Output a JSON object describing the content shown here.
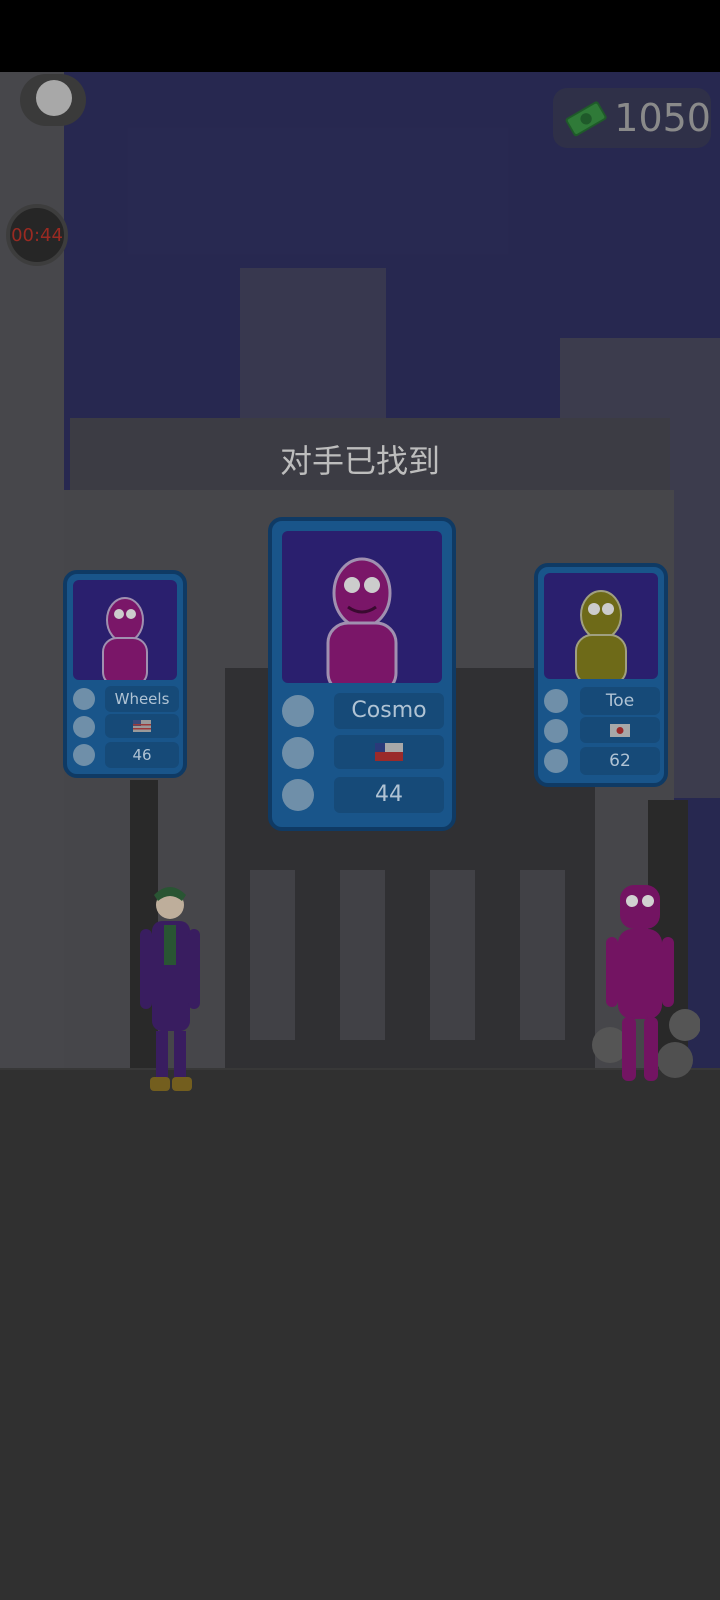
{
  "hud": {
    "timer": "00:44",
    "money": "1050",
    "colors": {
      "timer_text": "#9a2a22",
      "money_text": "#8a8a8a"
    }
  },
  "title": "对手已找到",
  "cards": {
    "left": {
      "name": "Wheels",
      "flag": "us-flag-icon",
      "level": "46"
    },
    "center": {
      "name": "Cosmo",
      "flag": "cl-flag-icon",
      "level": "44"
    },
    "right": {
      "name": "Toe",
      "flag": "jp-flag-icon",
      "level": "62"
    }
  },
  "colors": {
    "card_bg": "#19558a",
    "card_border": "#0f3a64",
    "portrait_bg": "#2a1f6e",
    "pink_character": "#b0168f",
    "yellow_character": "#a9a31a"
  }
}
